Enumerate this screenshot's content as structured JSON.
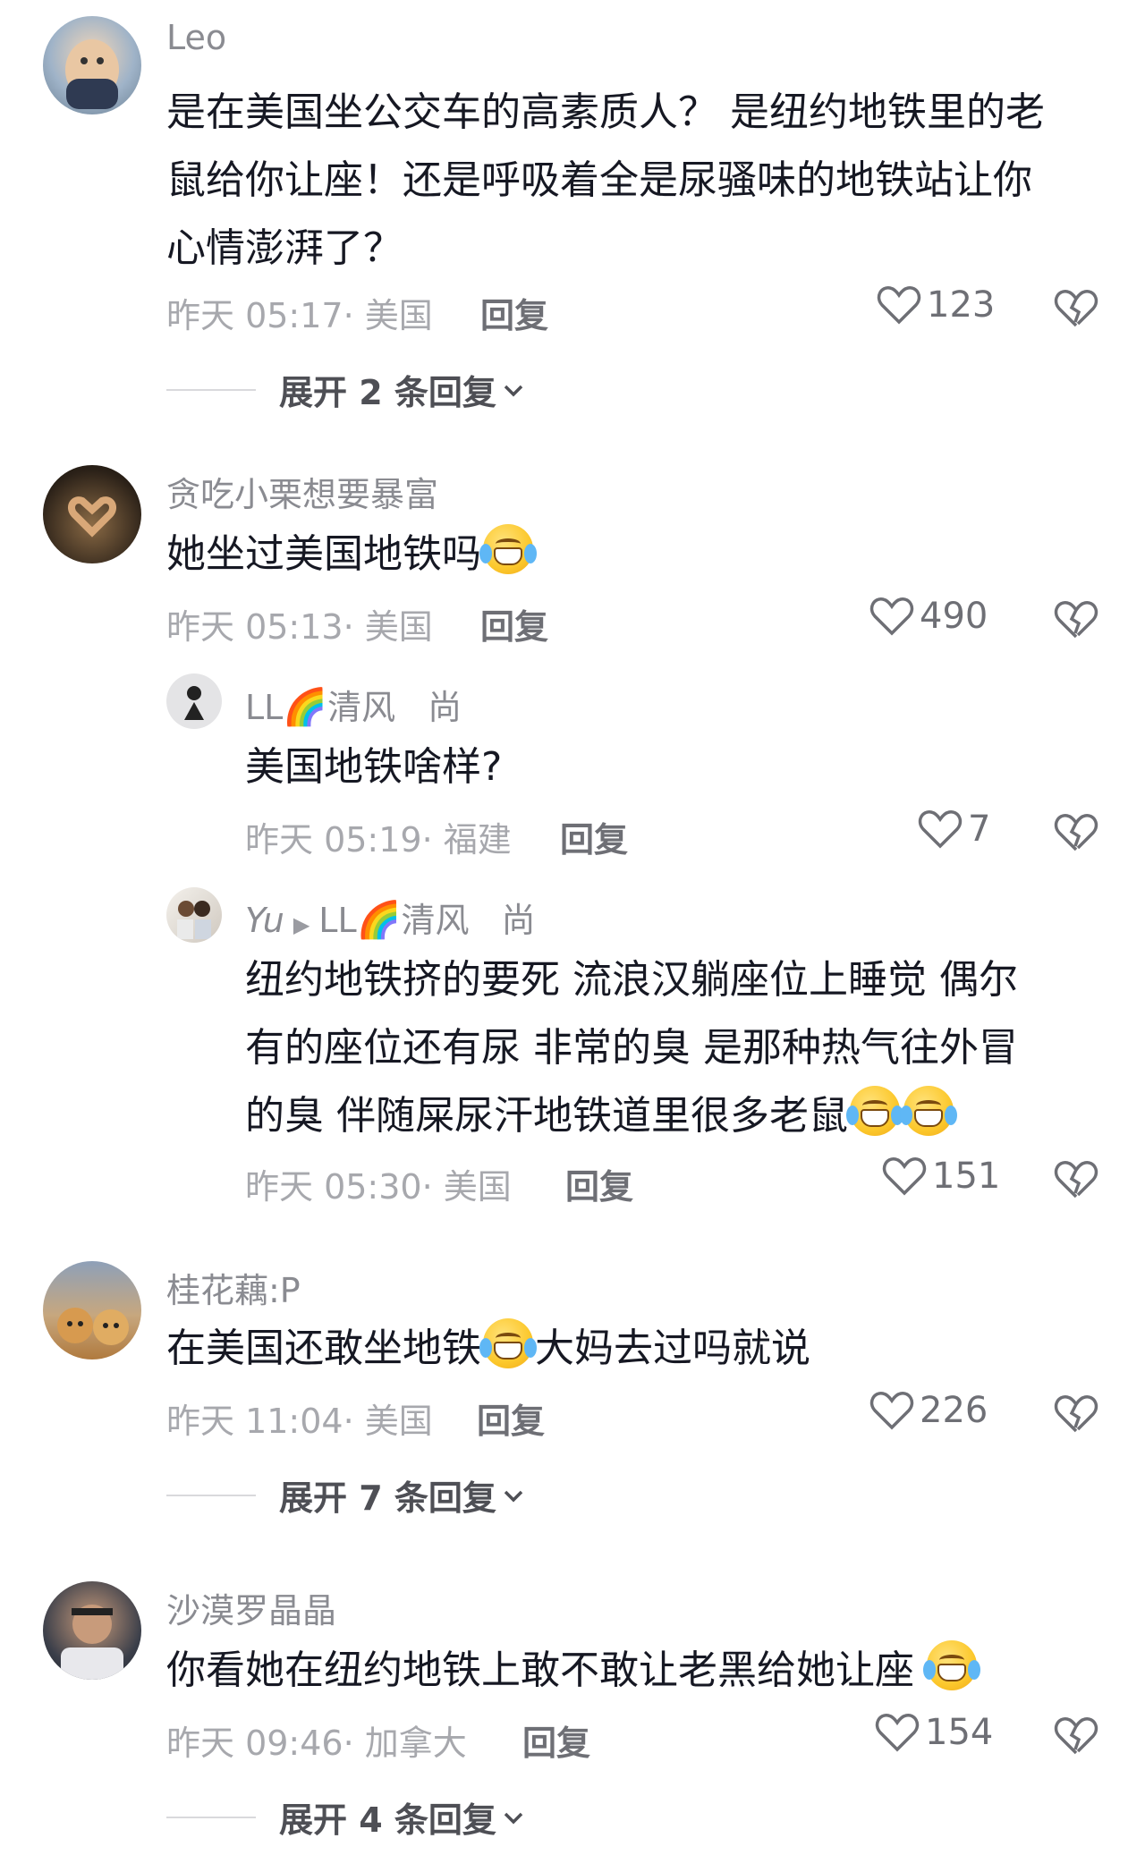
{
  "comments": [
    {
      "username": "Leo",
      "text_lines": [
        "是在美国坐公交车的高素质人？ 是纽约地铁里的老",
        "鼠给你让座！还是呼吸着全是尿骚味的地铁站让你",
        "心情澎湃了？"
      ],
      "meta": "昨天 05:17· 美国",
      "reply_label": "回复",
      "likes": "123",
      "expand_label": "展开 2 条回复",
      "avatar_icon": "cartoon-figure-avatar"
    },
    {
      "username": "贪吃小栗想要暴富",
      "text": "她坐过美国地铁吗",
      "meta": "昨天 05:13· 美国",
      "reply_label": "回复",
      "likes": "490",
      "avatar_icon": "heart-hands-avatar",
      "replies": [
        {
          "username": "LL",
          "username_suffix": "清风",
          "badge": "尚",
          "text": "美国地铁啥样?",
          "meta": "昨天 05:19· 福建",
          "reply_label": "回复",
          "likes": "7",
          "avatar_icon": "figure-avatar"
        },
        {
          "username": "Yu",
          "reply_to": "LL",
          "reply_to_suffix": "清风",
          "badge": "尚",
          "text_lines": [
            "纽约地铁挤的要死 流浪汉躺座位上睡觉  偶尔",
            "有的座位还有尿  非常的臭  是那种热气往外冒",
            "的臭  伴随屎尿汗地铁道里很多老鼠"
          ],
          "meta": "昨天 05:30· 美国",
          "reply_label": "回复",
          "likes": "151",
          "avatar_icon": "couple-photo-avatar"
        }
      ]
    },
    {
      "username": "桂花藕:P",
      "text_before": "在美国还敢坐地铁",
      "text_after": "大妈去过吗就说",
      "meta": "昨天 11:04· 美国",
      "reply_label": "回复",
      "likes": "226",
      "expand_label": "展开 7 条回复",
      "avatar_icon": "dogs-avatar"
    },
    {
      "username": "沙漠罗晶晶",
      "text": "你看她在纽约地铁上敢不敢让老黑给她让座",
      "meta": "昨天 09:46· 加拿大",
      "reply_label": "回复",
      "likes": "154",
      "expand_label": "展开 4 条回复",
      "avatar_icon": "football-player-avatar"
    }
  ],
  "colors": {
    "text": "#161823",
    "meta": "#a7a8ad",
    "name": "#8a8b91"
  }
}
